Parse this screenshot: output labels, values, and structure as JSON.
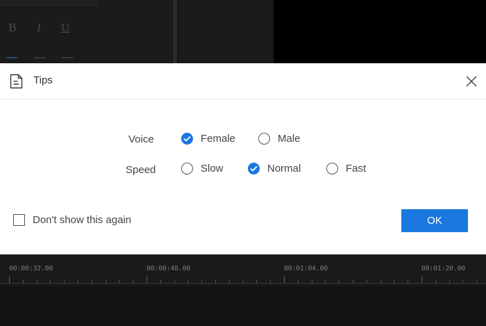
{
  "background": {
    "format_bold": "B",
    "format_italic": "I",
    "format_underline": "U",
    "timeline": {
      "labels": [
        "00:00:32.00",
        "00:00:48.00",
        "00:01:04.00",
        "00:01:20.00"
      ]
    }
  },
  "dialog": {
    "title": "Tips",
    "icon": "document-icon",
    "voice": {
      "label": "Voice",
      "options": [
        {
          "label": "Female",
          "checked": true
        },
        {
          "label": "Male",
          "checked": false
        }
      ]
    },
    "speed": {
      "label": "Speed",
      "options": [
        {
          "label": "Slow",
          "checked": false
        },
        {
          "label": "Normal",
          "checked": true
        },
        {
          "label": "Fast",
          "checked": false
        }
      ]
    },
    "dont_show_label": "Don't show this again",
    "dont_show_checked": false,
    "ok_label": "OK"
  },
  "colors": {
    "accent": "#1a78df",
    "dialog_bg": "#ffffff",
    "app_bg": "#141414"
  }
}
